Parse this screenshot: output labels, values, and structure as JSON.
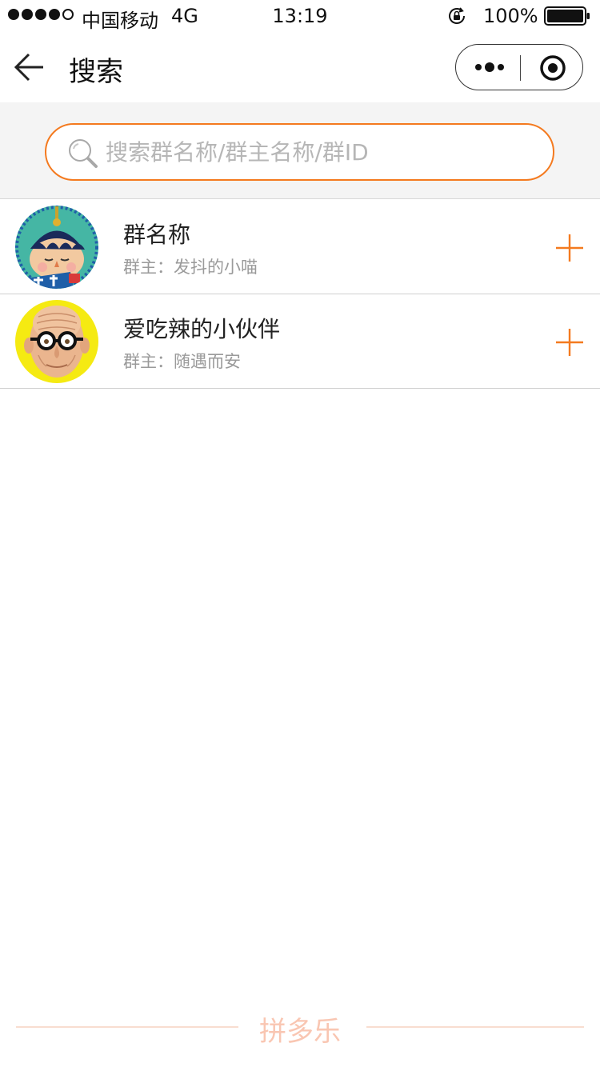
{
  "status_bar": {
    "carrier": "中国移动",
    "network": "4G",
    "time": "13:19",
    "battery": "100%"
  },
  "nav": {
    "title": "搜索",
    "back_icon": "back-arrow-icon",
    "more_icon": "more-dots-icon",
    "close_icon": "target-circle-icon"
  },
  "search": {
    "placeholder": "搜索群名称/群主名称/群ID",
    "value": "",
    "accent_color": "#f47a1f"
  },
  "groups": [
    {
      "name": "群名称",
      "owner": "群主：发抖的小喵",
      "avatar": "cartoon-boy-avatar",
      "add_icon": "plus-icon"
    },
    {
      "name": "爱吃辣的小伙伴",
      "owner": "群主：随遇而安",
      "avatar": "old-man-glasses-avatar",
      "add_icon": "plus-icon"
    }
  ],
  "footer": {
    "brand": "拼多乐"
  }
}
